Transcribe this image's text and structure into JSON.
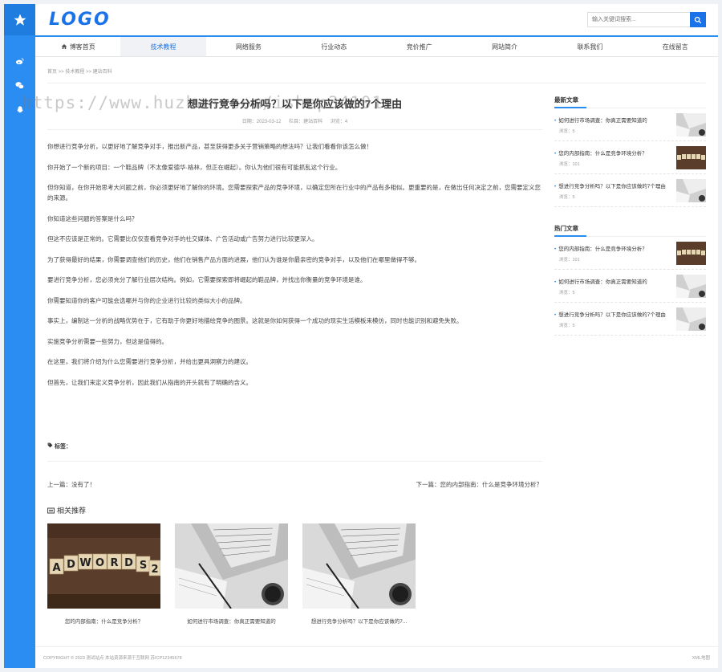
{
  "header": {
    "logo": "LOGO",
    "search_placeholder": "输入关键词搜索..."
  },
  "nav": [
    {
      "label": "博客首页",
      "active": false
    },
    {
      "label": "技术教程",
      "active": true
    },
    {
      "label": "网络服务",
      "active": false
    },
    {
      "label": "行业动态",
      "active": false
    },
    {
      "label": "竞价推广",
      "active": false
    },
    {
      "label": "网站简介",
      "active": false
    },
    {
      "label": "联系我们",
      "active": false
    },
    {
      "label": "在线留言",
      "active": false
    }
  ],
  "breadcrumb": "首页 >> 技术教程 >> 建站百科",
  "article": {
    "title": "想进行竞争分析吗？以下是你应该做的7个理由",
    "date": "日期：2023-03-12",
    "column": "栏目：建站百科",
    "views": "浏览：4",
    "paragraphs": [
      "你想进行竞争分析，以更好地了解竞争对手，推出新产品，甚至获得更多关于营销策略的想法吗？让我们看看你该怎么做！",
      "你开始了一个新的项目：一个鞋品牌（不太像爱德华·格林，但正在崛起）。你认为他们很有可能抓乱这个行业。",
      "但你知道，在你开始思考大问题之前，你必须更好地了解你的环境。您需要探索产品的竞争环境，以确定您所在行业中的产品有多相似。更重要的是，在做出任何决定之前，您需要定义您的来源。",
      "你知道这些问题的答案是什么吗？",
      "但这不应该是正常的。它需要比仅仅查看竞争对手的社交媒体、广告活动或广告努力进行比较更深入。",
      "为了获得最好的结果，你需要调查他们的历史，他们在销售产品方面的进展，他们认为谁是你最亲密的竞争对手，以及他们在哪里做得不够。",
      "要进行竞争分析，您必须充分了解行业层次结构。例如，它需要探索即将崛起的鞋品牌，并找出你衡量的竞争环境是谁。",
      "你需要知道你的客户可能会选哪并与你的企业进行比较的类似大小的品牌。",
      "事实上，编制这一分析的战略优势在于，它有助于你更好地描绘竞争的图景。这就是你如何获得一个成功的现实生活模板来模仿，同时也能识别和避免失败。",
      "实施竞争分析需要一些努力，但这是值得的。",
      "在这里，我们将介绍为什么您需要进行竞争分析，并给出更具洞察力的建议。",
      "但首先，让我们来定义竞争分析，因此我们从指南的开头就有了明确的含义。"
    ],
    "tags_label": "标签：",
    "prev": "上一篇：没有了！",
    "next": "下一篇：您的内部指南：什么是竞争环境分析？"
  },
  "related": {
    "title": "相关推荐",
    "items": [
      {
        "caption": "您的内部指南：什么是竞争分析？",
        "image": "adwords-tiles"
      },
      {
        "caption": "如何进行市场调查：你真正需要知道的",
        "image": "laptop-desk"
      },
      {
        "caption": "想进行竞争分析吗？以下是你应该做的7...",
        "image": "laptop-desk"
      }
    ]
  },
  "sidebar": {
    "latest_title": "最新文章",
    "latest": [
      {
        "title": "如何进行市场调查：你真正需要知道的",
        "views": "浏览：5",
        "image": "laptop-desk"
      },
      {
        "title": "您的内部指南：什么是竞争环境分析？",
        "views": "浏览：101",
        "image": "adwords-tiles"
      },
      {
        "title": "想进行竞争分析吗？以下是你应该做的7个理由",
        "views": "浏览：5",
        "image": "laptop-desk"
      }
    ],
    "hot_title": "热门文章",
    "hot": [
      {
        "title": "您的内部指南：什么是竞争环境分析？",
        "views": "浏览：101",
        "image": "adwords-tiles"
      },
      {
        "title": "如何进行市场调查：你真正需要知道的",
        "views": "浏览：5",
        "image": "laptop-desk"
      },
      {
        "title": "想进行竞争分析吗？以下是你应该做的7个理由",
        "views": "浏览：5",
        "image": "laptop-desk"
      }
    ]
  },
  "footer": {
    "copyright": "COPYRIGHT © 2023 测试站点 本站资源来源于互联网 苏ICP12345678",
    "sitemap": "XML地图"
  },
  "watermark": "https://www.huzhan.com/ishop34101",
  "icons": {
    "sidebar": [
      "star-icon",
      "weibo-icon",
      "wechat-icon",
      "qq-icon"
    ],
    "search": "search-icon",
    "home": "home-icon",
    "tag": "tag-icon",
    "related": "news-icon"
  },
  "colors": {
    "brand": "#2b8df2",
    "logo": "#1a72e8"
  }
}
